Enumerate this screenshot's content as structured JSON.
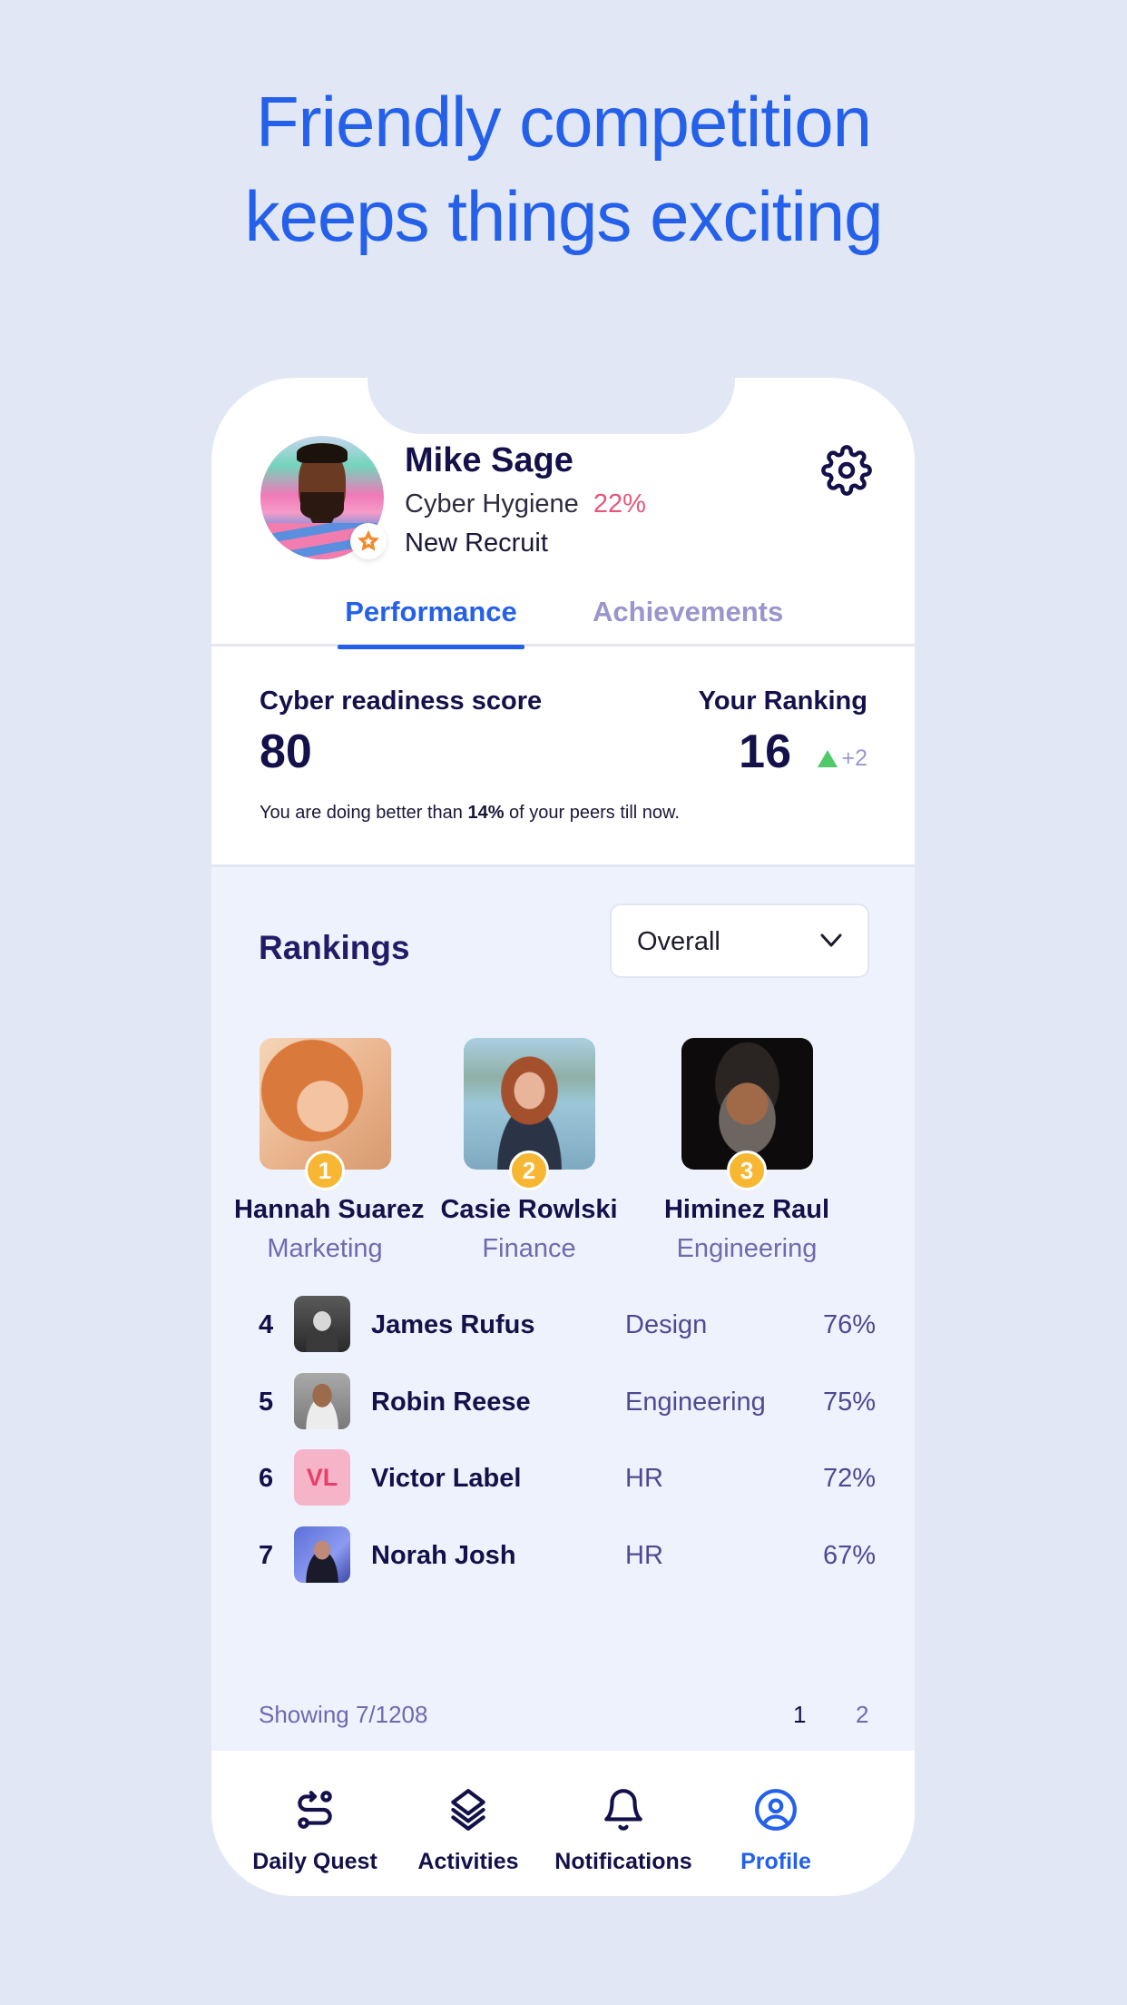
{
  "headline": {
    "line1": "Friendly competition",
    "line2": "keeps things exciting"
  },
  "profile": {
    "name": "Mike Sage",
    "hygiene_label": "Cyber Hygiene",
    "hygiene_pct": "22%",
    "rank_title": "New Recruit",
    "avatar_icon": "user-photo",
    "badge_icon": "star-badge-icon",
    "settings_icon": "gear-icon"
  },
  "tabs": [
    {
      "label": "Performance",
      "active": true
    },
    {
      "label": "Achievements",
      "active": false
    }
  ],
  "score": {
    "label": "Cyber readiness score",
    "value": "80",
    "ranking_label": "Your Ranking",
    "ranking_value": "16",
    "ranking_delta": "+2",
    "peer_text_prefix": "You are doing better than ",
    "peer_text_pct": "14%",
    "peer_text_suffix": " of your peers till now."
  },
  "rankings": {
    "heading": "Rankings",
    "filter": {
      "selected": "Overall"
    },
    "podium": [
      {
        "rank": "1",
        "name": "Hannah Suarez",
        "dept": "Marketing"
      },
      {
        "rank": "2",
        "name": "Casie Rowlski",
        "dept": "Finance"
      },
      {
        "rank": "3",
        "name": "Himinez Raul",
        "dept": "Engineering"
      }
    ],
    "list": [
      {
        "rank": "4",
        "name": "James Rufus",
        "dept": "Design",
        "pct": "76%"
      },
      {
        "rank": "5",
        "name": "Robin Reese",
        "dept": "Engineering",
        "pct": "75%"
      },
      {
        "rank": "6",
        "name": "Victor Label",
        "dept": "HR",
        "pct": "72%",
        "initials": "VL"
      },
      {
        "rank": "7",
        "name": "Norah Josh",
        "dept": "HR",
        "pct": "67%"
      }
    ],
    "showing": "Showing 7/1208",
    "pages": [
      "1",
      "2"
    ],
    "current_page": "1"
  },
  "nav": [
    {
      "label": "Daily Quest",
      "icon": "route-icon",
      "active": false
    },
    {
      "label": "Activities",
      "icon": "layers-icon",
      "active": false
    },
    {
      "label": "Notifications",
      "icon": "bell-icon",
      "active": false
    },
    {
      "label": "Profile",
      "icon": "user-circle-icon",
      "active": true
    }
  ],
  "colors": {
    "accent": "#2460EA",
    "background": "#E1E7F5",
    "panel": "#EEF2FD",
    "hygiene": "#E5567A",
    "positive": "#4FC96A",
    "medal": "#F7B733"
  }
}
